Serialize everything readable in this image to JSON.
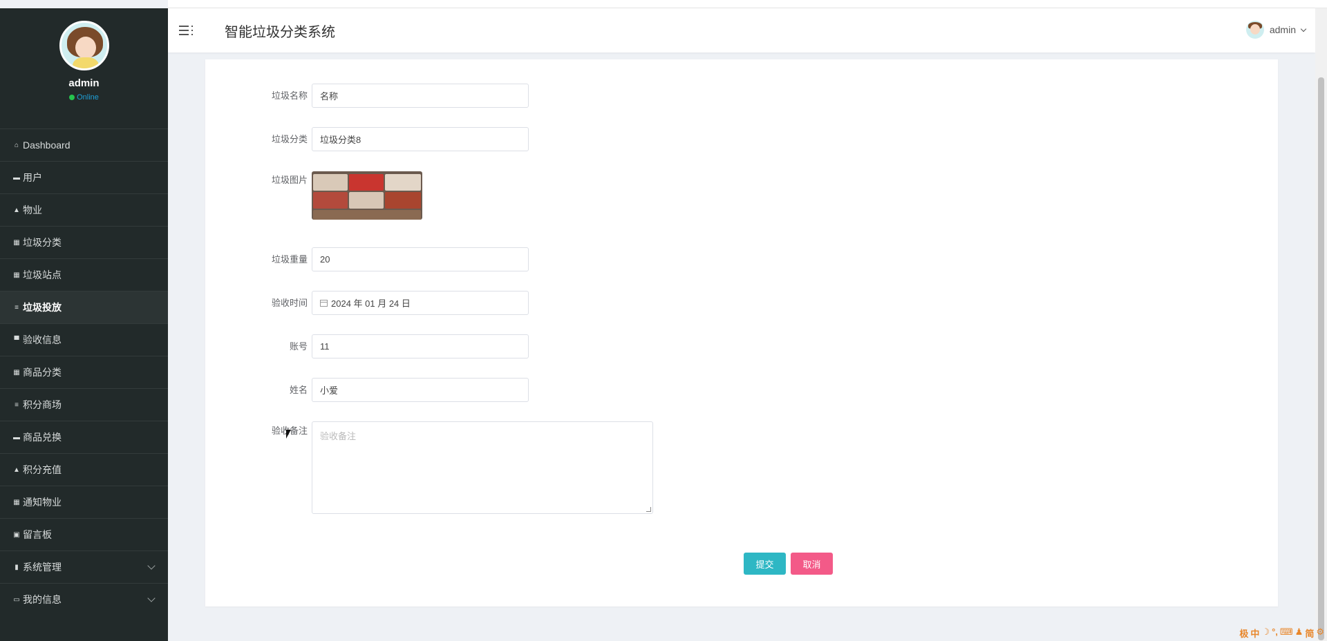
{
  "app": {
    "title": "智能垃圾分类系统"
  },
  "profile": {
    "name": "admin",
    "status": "Online"
  },
  "header_user": {
    "name": "admin"
  },
  "sidebar": {
    "items": [
      {
        "label": "Dashboard",
        "icon": "home-icon",
        "glyph": "⌂"
      },
      {
        "label": "用户",
        "icon": "users-icon",
        "glyph": "▬"
      },
      {
        "label": "物业",
        "icon": "user-icon",
        "glyph": "▲"
      },
      {
        "label": "垃圾分类",
        "icon": "grid-icon",
        "glyph": "▦"
      },
      {
        "label": "垃圾站点",
        "icon": "grid-icon",
        "glyph": "▦"
      },
      {
        "label": "垃圾投放",
        "icon": "list-icon",
        "glyph": "≡"
      },
      {
        "label": "验收信息",
        "icon": "monitor-icon",
        "glyph": "▀"
      },
      {
        "label": "商品分类",
        "icon": "table-icon",
        "glyph": "▦"
      },
      {
        "label": "积分商场",
        "icon": "list-icon",
        "glyph": "≡"
      },
      {
        "label": "商品兑换",
        "icon": "ticket-icon",
        "glyph": "▬"
      },
      {
        "label": "积分充值",
        "icon": "user-icon",
        "glyph": "▲"
      },
      {
        "label": "通知物业",
        "icon": "grid-icon",
        "glyph": "▦"
      },
      {
        "label": "留言板",
        "icon": "clipboard-icon",
        "glyph": "▣"
      },
      {
        "label": "系统管理",
        "icon": "bar-chart-icon",
        "glyph": "▮"
      },
      {
        "label": "我的信息",
        "icon": "id-card-icon",
        "glyph": "▭"
      }
    ]
  },
  "form": {
    "name": {
      "label": "垃圾名称",
      "value": "名称"
    },
    "category": {
      "label": "垃圾分类",
      "value": "垃圾分类8"
    },
    "image": {
      "label": "垃圾图片"
    },
    "weight": {
      "label": "垃圾重量",
      "value": "20"
    },
    "time": {
      "label": "验收时间",
      "value": "2024 年 01 月 24 日"
    },
    "account": {
      "label": "账号",
      "value": "11"
    },
    "person": {
      "label": "姓名",
      "value": "小爱"
    },
    "remark": {
      "label": "验收备注",
      "placeholder": "验收备注"
    },
    "submit": "提交",
    "cancel": "取消"
  },
  "ime_bar": [
    "极",
    "中",
    "☽",
    "°,",
    "⌨",
    "♟",
    "简",
    "⚙"
  ],
  "colors": {
    "sidebar_bg": "#222a2a",
    "accent_submit": "#2eb7c4",
    "accent_cancel": "#f35a88",
    "status_online": "#26c24e"
  }
}
